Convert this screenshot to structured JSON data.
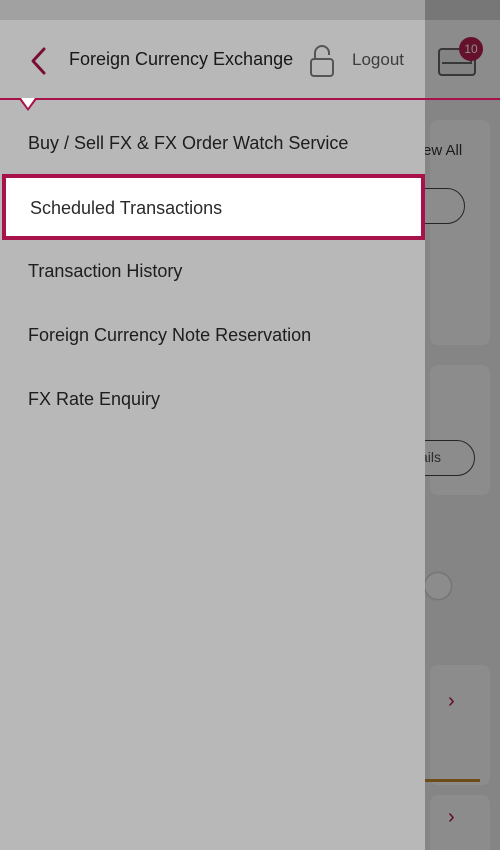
{
  "header": {
    "title": "Foreign Currency Exchange",
    "logout_label": "Logout",
    "badge_count": "10"
  },
  "menu": {
    "items": [
      {
        "label": "Buy / Sell FX & FX Order Watch Service"
      },
      {
        "label": "Scheduled Transactions"
      },
      {
        "label": "Transaction History"
      },
      {
        "label": "Foreign Currency Note Reservation"
      },
      {
        "label": "FX Rate Enquiry"
      }
    ],
    "highlighted_index": 1
  },
  "background": {
    "view_all_label": "ew All",
    "details_label": "ails"
  },
  "colors": {
    "accent": "#a8124a",
    "badge": "#b8204f",
    "text": "#2a2a2a"
  }
}
